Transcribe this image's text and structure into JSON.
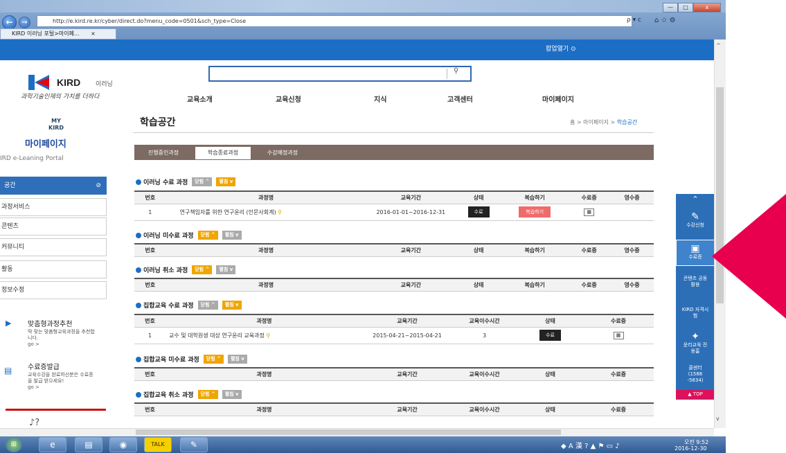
{
  "browser": {
    "url": "http://e.kird.re.kr/cyber/direct.do?menu_code=0501&sch_type=Close",
    "tab_title": "KIRD 이러닝 포털>마이페...",
    "tab_close": "×",
    "back_icon": "back-arrow-icon",
    "forward_icon": "forward-arrow-icon",
    "search_refresh": "ρ ▾ c",
    "window_controls": [
      "—",
      "□",
      "x"
    ]
  },
  "popup_bar": {
    "label": "팝업열기 ⊙"
  },
  "header": {
    "logo_text": "KIRD",
    "logo_sub": "이러닝",
    "slogan": "과학기술인재의 가치를 더하다",
    "search_placeholder": "",
    "nav": [
      "교육소개",
      "교육신청",
      "지식",
      "고객센터",
      "마이페이지"
    ]
  },
  "sidebar": {
    "my_icon": "MY KIRD",
    "title": "마이페이지",
    "portal": "IRD e-Leaning Portal",
    "active_item": "공간",
    "items": [
      "과정서비스",
      "콘텐츠",
      "커뮤니티",
      "활동",
      "정보수정"
    ],
    "promo1": {
      "title": "맞춤형과정추천",
      "text": "딱 맞는 맞춤형교육과정을 추천합니다.",
      "go": "go >"
    },
    "promo2": {
      "title": "수료증발급",
      "text": "교육수강을 완료하신분은 수료증을 발급 받으세요!",
      "go": "go >"
    }
  },
  "content": {
    "title": "학습공간",
    "breadcrumb": "홈 > 마이페이지 > ",
    "breadcrumb_current": "학습공간",
    "tabs": [
      "진행중인과정",
      "학습종료과정",
      "수강예정과정"
    ],
    "fold": "닫힘 ^",
    "unfold": "펼침 v",
    "sections": [
      {
        "title": "이러닝 수료 과정",
        "headers": [
          "번호",
          "과정명",
          "교육기간",
          "상태",
          "복습하기",
          "수료증",
          "영수증"
        ],
        "rows": [
          {
            "no": "1",
            "name": "연구책임자를 위한 연구윤리 (인문사회계)",
            "period": "2016-01-01~2016-12-31",
            "status": "수료",
            "review": "복습하기"
          }
        ]
      },
      {
        "title": "이러닝 미수료 과정",
        "headers": [
          "번호",
          "과정명",
          "교육기간",
          "상태",
          "복습하기",
          "수료증",
          "영수증"
        ]
      },
      {
        "title": "이러닝 취소 과정",
        "headers": [
          "번호",
          "과정명",
          "교육기간",
          "상태",
          "복습하기",
          "수료증",
          "영수증"
        ]
      },
      {
        "title": "집합교육 수료 과정",
        "headers": [
          "번호",
          "과정명",
          "교육기간",
          "교육이수시간",
          "상태",
          "수료증"
        ],
        "rows": [
          {
            "no": "1",
            "name": "교수 및 대학원생 대상 연구윤리 교육과정",
            "period": "2015-04-21~2015-04-21",
            "hours": "3",
            "status": "수료"
          }
        ]
      },
      {
        "title": "집합교육 미수료 과정",
        "headers": [
          "번호",
          "과정명",
          "교육기간",
          "교육이수시간",
          "상태",
          "수료증"
        ]
      },
      {
        "title": "집합교육 취소 과정",
        "headers": [
          "번호",
          "과정명",
          "교육기간",
          "교육이수시간",
          "상태",
          "수료증"
        ]
      }
    ]
  },
  "quick_menu": {
    "items": [
      {
        "label": "수강신청",
        "icon": "document-pen-icon"
      },
      {
        "label": "수료증",
        "icon": "certificate-card-icon"
      },
      {
        "label": "콘텐츠 공동활용",
        "icon": ""
      },
      {
        "label": "KIRD 자격시험",
        "icon": ""
      },
      {
        "label": "윤리교육 전용홈",
        "icon": "sprout-icon"
      },
      {
        "label": "콜센터 (1588 -5834)",
        "icon": ""
      }
    ],
    "top": "▲ TOP",
    "up_icon": "double-chevron-up-icon"
  },
  "taskbar": {
    "time": "오전 9:52",
    "date": "2016-12-30",
    "tray": "A 漢"
  },
  "annotation": {
    "color": "#e8004f"
  }
}
